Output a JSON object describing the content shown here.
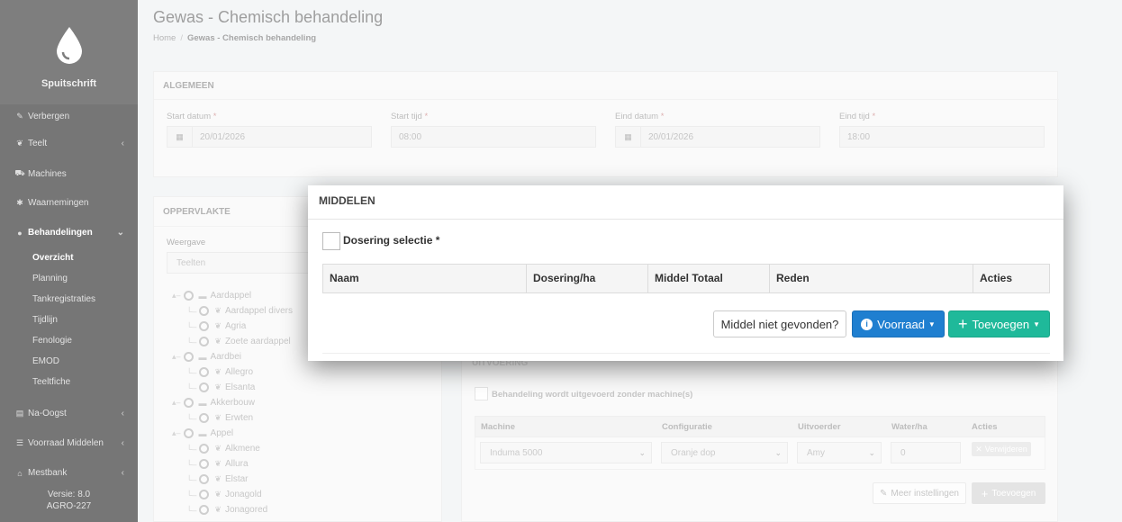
{
  "sidebar": {
    "app_name": "Spuitschrift",
    "items": [
      {
        "label": "Verbergen",
        "icon": "brush-icon"
      },
      {
        "label": "Teelt",
        "icon": "leaf-icon"
      },
      {
        "label": "Machines",
        "icon": "tractor-icon"
      },
      {
        "label": "Waarnemingen",
        "icon": "bug-icon"
      },
      {
        "label": "Behandelingen",
        "icon": "drop-icon"
      },
      {
        "label": "Na-Oogst",
        "icon": "box-icon"
      },
      {
        "label": "Voorraad Middelen",
        "icon": "list-icon"
      },
      {
        "label": "Mestbank",
        "icon": "bank-icon"
      }
    ],
    "sub_items": [
      "Overzicht",
      "Planning",
      "Tankregistraties",
      "Tijdlijn",
      "Fenologie",
      "EMOD",
      "Teeltfiche"
    ],
    "version_line1": "Versie: 8.0",
    "version_line2": "AGRO-227"
  },
  "header": {
    "title": "Gewas - Chemisch behandeling",
    "breadcrumb_home": "Home",
    "breadcrumb_sep": "/",
    "breadcrumb_current": "Gewas - Chemisch behandeling"
  },
  "algemeen": {
    "title": "ALGEMEEN",
    "star": "*",
    "start_datum_label": "Start datum",
    "start_datum_value": "20/01/2026",
    "start_tijd_label": "Start tijd",
    "start_tijd_value": "08:00",
    "eind_datum_label": "Eind datum",
    "eind_datum_value": "20/01/2026",
    "eind_tijd_label": "Eind tijd",
    "eind_tijd_value": "18:00"
  },
  "oppervlakte": {
    "title": "OPPERVLAKTE",
    "weergave_label": "Weergave",
    "weergave_value": "Teelten",
    "tree": [
      {
        "label": "Aardappel",
        "level": 0
      },
      {
        "label": "Aardappel divers",
        "level": 1
      },
      {
        "label": "Agria",
        "level": 1
      },
      {
        "label": "Zoete aardappel",
        "level": 1
      },
      {
        "label": "Aardbei",
        "level": 0
      },
      {
        "label": "Allegro",
        "level": 1
      },
      {
        "label": "Elsanta",
        "level": 1
      },
      {
        "label": "Akkerbouw",
        "level": 0
      },
      {
        "label": "Erwten",
        "level": 1
      },
      {
        "label": "Appel",
        "level": 0
      },
      {
        "label": "Alkmene",
        "level": 1
      },
      {
        "label": "Allura",
        "level": 1
      },
      {
        "label": "Elstar",
        "level": 1
      },
      {
        "label": "Jonagold",
        "level": 1
      },
      {
        "label": "Jonagored",
        "level": 1
      }
    ]
  },
  "uitvoering": {
    "title": "UITVOERING",
    "checkbox_label": "Behandeling wordt uitgevoerd zonder machine(s)",
    "columns": [
      "Machine",
      "Configuratie",
      "Uitvoerder",
      "Water/ha",
      "Acties"
    ],
    "row": {
      "machine": "Induma 5000",
      "configuratie": "Oranje dop",
      "uitvoerder": "Amy",
      "water": "0",
      "delete_label": "Verwijderen"
    },
    "meer_label": "Meer instellingen",
    "toevoegen_label": "Toevoegen"
  },
  "modal": {
    "title": "MIDDELEN",
    "dosering_label": "Dosering selectie *",
    "columns": [
      "Naam",
      "Dosering/ha",
      "Middel Totaal",
      "Reden",
      "Acties"
    ],
    "niet_gevonden_label": "Middel niet gevonden?",
    "voorraad_label": "Voorraad",
    "toevoegen_label": "Toevoegen"
  },
  "colors": {
    "sidebar_bg": "#2d2d2d",
    "blue_button": "#1f7fd0",
    "teal_button": "#1fb99a"
  }
}
